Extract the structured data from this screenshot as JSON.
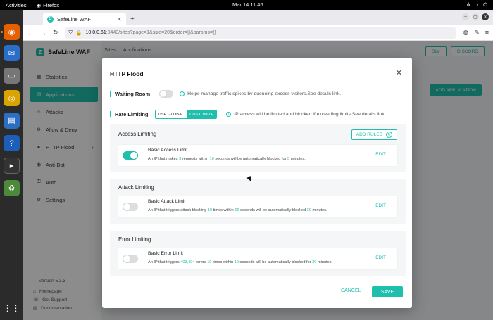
{
  "os": {
    "activities": "Activities",
    "app_name": "Firefox",
    "clock": "Mar 14  11:46"
  },
  "browser": {
    "tab_title": "SafeLine WAF",
    "url_host": "10.0.0.61",
    "url_path": ":9443/sites?page=1&size=20&order=[]&params={}"
  },
  "app": {
    "brand": "SafeLine WAF",
    "breadcrumb": [
      "Sites",
      "Applications"
    ],
    "menu": [
      {
        "icon": "▦",
        "label": "Statistics",
        "active": false
      },
      {
        "icon": "▤",
        "label": "Applications",
        "active": true
      },
      {
        "icon": "⚠",
        "label": "Attacks",
        "active": false
      },
      {
        "icon": "⊘",
        "label": "Allow & Deny",
        "active": false
      },
      {
        "icon": "♠",
        "label": "HTTP Flood",
        "active": false
      },
      {
        "icon": "◉",
        "label": "Anti-Bot",
        "active": false
      },
      {
        "icon": "⚿",
        "label": "Auth",
        "active": false
      },
      {
        "icon": "⚙",
        "label": "Settings",
        "active": false
      }
    ],
    "version": "Version 5.3.3",
    "footer_links": [
      "Homepage",
      "Get Support",
      "Documentation"
    ],
    "top_buttons": [
      "Star",
      "DISCORD"
    ],
    "add_application": "ADD APPLICATION"
  },
  "modal": {
    "title": "HTTP Flood",
    "waiting_room": {
      "label": "Waiting Room",
      "enabled": false,
      "info": "Helps manage traffic spikes by queueing excess visitors.See details link."
    },
    "rate_limiting": {
      "label": "Rate Limiting",
      "options": [
        "USE GLOBAL",
        "CUSTOMIZE"
      ],
      "selected": "CUSTOMIZE",
      "info": "IP access will be limited and blocked if exceeding limits.See details link."
    },
    "access": {
      "title": "Access Limiting",
      "add_rules": "ADD RULES",
      "rule": {
        "name": "Basic Access Limit",
        "enabled": true,
        "p1": "An IP that makes ",
        "n1": "3",
        "p2": " requests within ",
        "n2": "10",
        "p3": " seconds will be automatically blocked for ",
        "n3": "5",
        "p4": " minutes.",
        "edit": "EDIT"
      }
    },
    "attack": {
      "title": "Attack Limiting",
      "rule": {
        "name": "Basic Attack Limit",
        "enabled": false,
        "p1": "An IP that triggers attack blocking ",
        "n1": "10",
        "p2": " times within ",
        "n2": "60",
        "p3": " seconds will be automatically blocked ",
        "n3": "30",
        "p4": " minutes.",
        "edit": "EDIT"
      }
    },
    "error": {
      "title": "Error Limiting",
      "rule": {
        "name": "Basic Error Limit",
        "enabled": false,
        "p1": "An IP that triggers ",
        "n1": "403,404",
        "p2": " errors ",
        "n2": "10",
        "p3": " times within ",
        "n3": "10",
        "p4": " seconds will be automatically blocked for ",
        "n4": "30",
        "p5": " minutes.",
        "edit": "EDIT"
      }
    },
    "cancel": "CANCEL",
    "save": "SAVE"
  },
  "colors": {
    "accent": "#1fbfae"
  }
}
